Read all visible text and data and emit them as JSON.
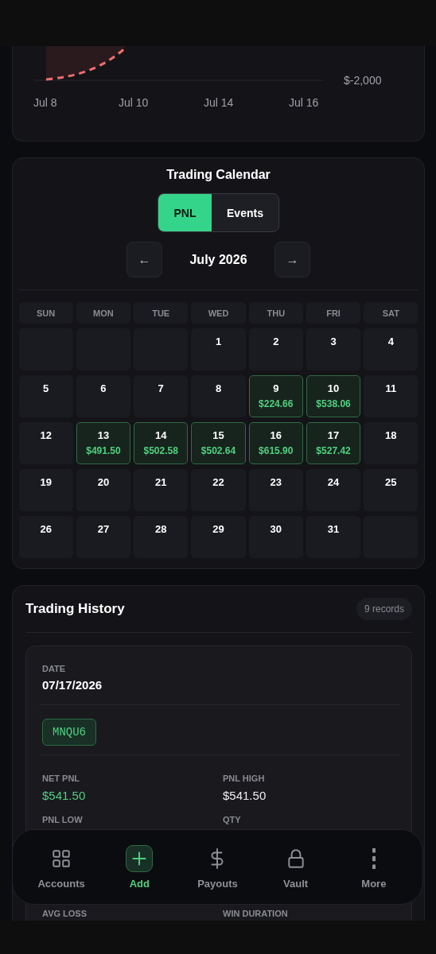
{
  "chart": {
    "x_labels": [
      "Jul 8",
      "Jul 10",
      "Jul 14",
      "Jul 16"
    ],
    "y_label": "$-2,000"
  },
  "calendar": {
    "title": "Trading Calendar",
    "modes": [
      {
        "label": "PNL",
        "selected": true
      },
      {
        "label": "Events",
        "selected": false
      }
    ],
    "prev": "←",
    "month": "July 2026",
    "next": "→",
    "weekdays": [
      "SUN",
      "MON",
      "TUE",
      "WED",
      "THU",
      "FRI",
      "SAT"
    ],
    "weeks": [
      [
        {
          "kind": "blank"
        },
        {
          "kind": "blank"
        },
        {
          "kind": "blank"
        },
        {
          "kind": "day",
          "day": "1"
        },
        {
          "kind": "day",
          "day": "2"
        },
        {
          "kind": "day",
          "day": "3"
        },
        {
          "kind": "day",
          "day": "4"
        }
      ],
      [
        {
          "kind": "day",
          "day": "5"
        },
        {
          "kind": "day",
          "day": "6"
        },
        {
          "kind": "day",
          "day": "7"
        },
        {
          "kind": "day",
          "day": "8"
        },
        {
          "kind": "profit",
          "day": "9",
          "pnl": "$224.66"
        },
        {
          "kind": "profit",
          "day": "10",
          "pnl": "$538.06"
        },
        {
          "kind": "day",
          "day": "11"
        }
      ],
      [
        {
          "kind": "day",
          "day": "12"
        },
        {
          "kind": "profit",
          "day": "13",
          "pnl": "$491.50"
        },
        {
          "kind": "profit",
          "day": "14",
          "pnl": "$502.58"
        },
        {
          "kind": "profit",
          "day": "15",
          "pnl": "$502.64"
        },
        {
          "kind": "profit",
          "day": "16",
          "pnl": "$615.90"
        },
        {
          "kind": "profit",
          "day": "17",
          "pnl": "$527.42"
        },
        {
          "kind": "day",
          "day": "18"
        }
      ],
      [
        {
          "kind": "day",
          "day": "19"
        },
        {
          "kind": "day",
          "day": "20"
        },
        {
          "kind": "day",
          "day": "21"
        },
        {
          "kind": "day",
          "day": "22"
        },
        {
          "kind": "day",
          "day": "23"
        },
        {
          "kind": "day",
          "day": "24"
        },
        {
          "kind": "day",
          "day": "25"
        }
      ],
      [
        {
          "kind": "day",
          "day": "26"
        },
        {
          "kind": "day",
          "day": "27"
        },
        {
          "kind": "day",
          "day": "28"
        },
        {
          "kind": "day",
          "day": "29"
        },
        {
          "kind": "day",
          "day": "30"
        },
        {
          "kind": "day",
          "day": "31"
        },
        {
          "kind": "blank"
        }
      ]
    ]
  },
  "history": {
    "title": "Trading History",
    "count": "9 records",
    "record": {
      "date_label": "DATE",
      "date": "07/17/2026",
      "symbol": "MNQU6",
      "fields": [
        {
          "label": "NET PNL",
          "value": "$541.50",
          "positive": true
        },
        {
          "label": "PNL HIGH",
          "value": "$541.50",
          "positive": false
        },
        {
          "label": "PNL LOW"
        },
        {
          "label": "QTY"
        },
        {
          "label": "AVG LOSS"
        },
        {
          "label": "WIN DURATION"
        }
      ]
    }
  },
  "nav": [
    {
      "label": "Accounts",
      "selected": false
    },
    {
      "label": "Add",
      "selected": true
    },
    {
      "label": "Payouts",
      "selected": false
    },
    {
      "label": "Vault",
      "selected": false
    },
    {
      "label": "More",
      "selected": false
    }
  ]
}
